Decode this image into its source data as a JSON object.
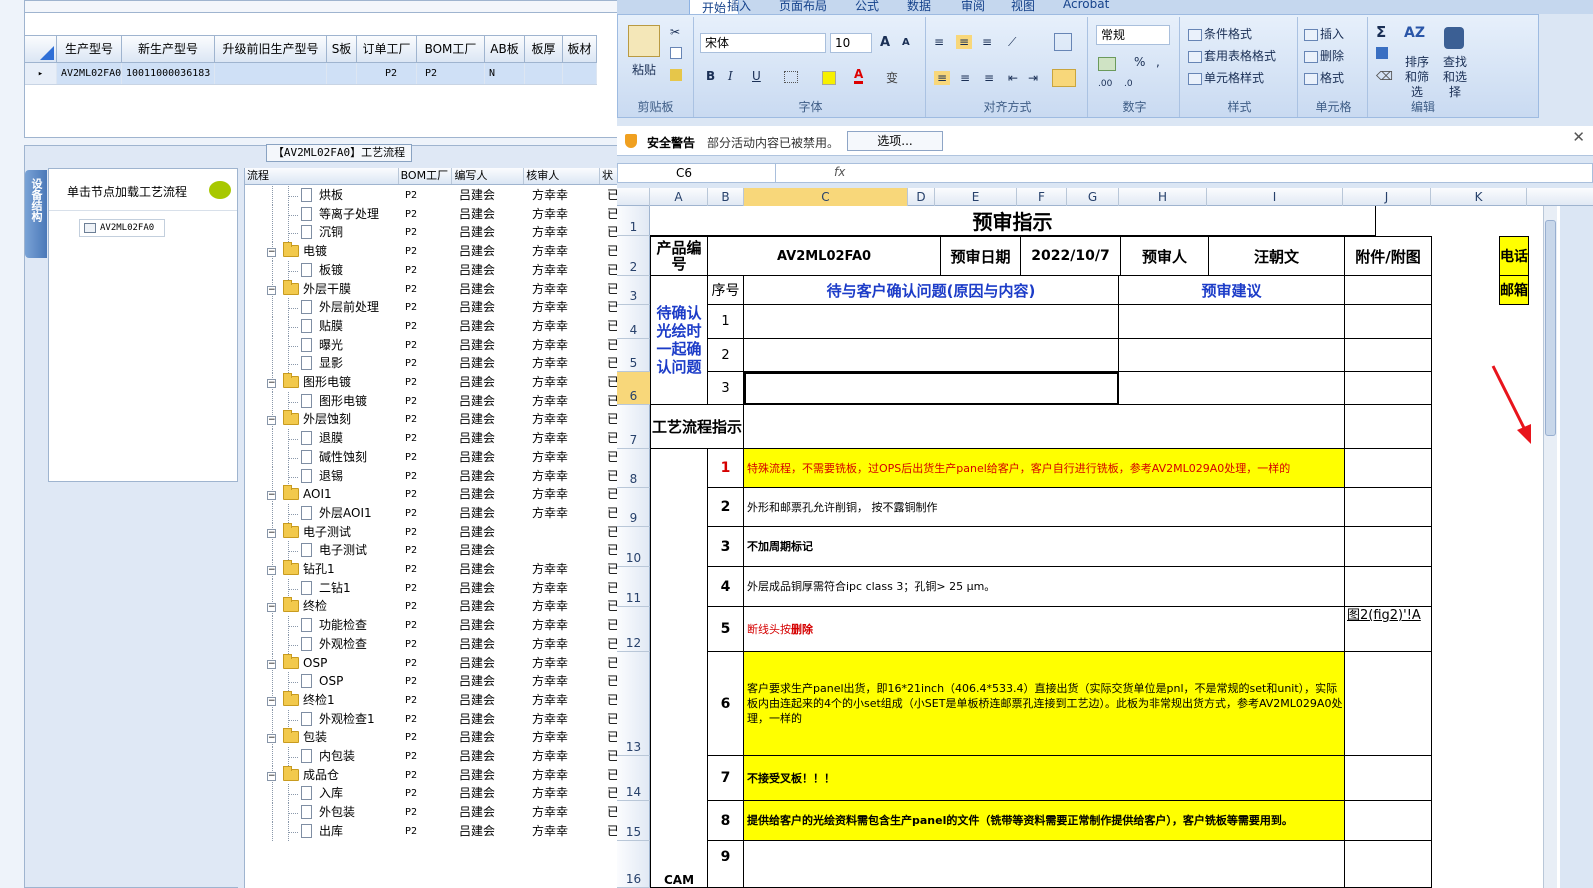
{
  "top_grid": {
    "headers": [
      "生产型号",
      "新生产型号",
      "升级前旧生产型号",
      "S板",
      "订单工厂",
      "BOM工厂",
      "AB板",
      "板厚",
      "板材"
    ],
    "row": {
      "pointer": "▸",
      "cells": [
        "AV2ML02FA0",
        "10011000036183",
        "",
        "",
        "P2",
        "P2",
        "N",
        "",
        ""
      ]
    }
  },
  "process_title": "【AV2ML02FA0】工艺流程",
  "side_tab": "设备结构",
  "left_pane": {
    "header": "单击节点加载工艺流程",
    "node": "AV2ML02FA0"
  },
  "tree": {
    "columns": [
      "流程",
      "BOM工厂",
      "编写人",
      "核审人",
      "状"
    ],
    "rows": [
      {
        "name": "烘板",
        "level": 1,
        "bom": "P2",
        "writer": "吕建会",
        "checker": "方幸幸",
        "status": "已"
      },
      {
        "name": "等离子处理",
        "level": 1,
        "bom": "P2",
        "writer": "吕建会",
        "checker": "方幸幸",
        "status": "已"
      },
      {
        "name": "沉铜",
        "level": 1,
        "bom": "P2",
        "writer": "吕建会",
        "checker": "方幸幸",
        "status": "已"
      },
      {
        "name": "电镀",
        "level": 0,
        "bom": "P2",
        "writer": "吕建会",
        "checker": "方幸幸",
        "status": "已"
      },
      {
        "name": "板镀",
        "level": 1,
        "bom": "P2",
        "writer": "吕建会",
        "checker": "方幸幸",
        "status": "已"
      },
      {
        "name": "外层干膜",
        "level": 0,
        "bom": "P2",
        "writer": "吕建会",
        "checker": "方幸幸",
        "status": "已"
      },
      {
        "name": "外层前处理",
        "level": 1,
        "bom": "P2",
        "writer": "吕建会",
        "checker": "方幸幸",
        "status": "已"
      },
      {
        "name": "贴膜",
        "level": 1,
        "bom": "P2",
        "writer": "吕建会",
        "checker": "方幸幸",
        "status": "已"
      },
      {
        "name": "曝光",
        "level": 1,
        "bom": "P2",
        "writer": "吕建会",
        "checker": "方幸幸",
        "status": "已"
      },
      {
        "name": "显影",
        "level": 1,
        "bom": "P2",
        "writer": "吕建会",
        "checker": "方幸幸",
        "status": "已"
      },
      {
        "name": "图形电镀",
        "level": 0,
        "bom": "P2",
        "writer": "吕建会",
        "checker": "方幸幸",
        "status": "已"
      },
      {
        "name": "图形电镀",
        "level": 1,
        "bom": "P2",
        "writer": "吕建会",
        "checker": "方幸幸",
        "status": "已"
      },
      {
        "name": "外层蚀刻",
        "level": 0,
        "bom": "P2",
        "writer": "吕建会",
        "checker": "方幸幸",
        "status": "已"
      },
      {
        "name": "退膜",
        "level": 1,
        "bom": "P2",
        "writer": "吕建会",
        "checker": "方幸幸",
        "status": "已"
      },
      {
        "name": "碱性蚀刻",
        "level": 1,
        "bom": "P2",
        "writer": "吕建会",
        "checker": "方幸幸",
        "status": "已"
      },
      {
        "name": "退锡",
        "level": 1,
        "bom": "P2",
        "writer": "吕建会",
        "checker": "方幸幸",
        "status": "已"
      },
      {
        "name": "AOI1",
        "level": 0,
        "bom": "P2",
        "writer": "吕建会",
        "checker": "方幸幸",
        "status": "已"
      },
      {
        "name": "外层AOI1",
        "level": 1,
        "bom": "P2",
        "writer": "吕建会",
        "checker": "方幸幸",
        "status": "已"
      },
      {
        "name": "电子测试",
        "level": 0,
        "bom": "P2",
        "writer": "吕建会",
        "checker": "",
        "status": "已"
      },
      {
        "name": "电子测试",
        "level": 1,
        "bom": "P2",
        "writer": "吕建会",
        "checker": "",
        "status": "已"
      },
      {
        "name": "钻孔1",
        "level": 0,
        "bom": "P2",
        "writer": "吕建会",
        "checker": "方幸幸",
        "status": "已"
      },
      {
        "name": "二钻1",
        "level": 1,
        "bom": "P2",
        "writer": "吕建会",
        "checker": "方幸幸",
        "status": "已"
      },
      {
        "name": "终检",
        "level": 0,
        "bom": "P2",
        "writer": "吕建会",
        "checker": "方幸幸",
        "status": "已"
      },
      {
        "name": "功能检查",
        "level": 1,
        "bom": "P2",
        "writer": "吕建会",
        "checker": "方幸幸",
        "status": "已"
      },
      {
        "name": "外观检查",
        "level": 1,
        "bom": "P2",
        "writer": "吕建会",
        "checker": "方幸幸",
        "status": "已"
      },
      {
        "name": "OSP",
        "level": 0,
        "bom": "P2",
        "writer": "吕建会",
        "checker": "方幸幸",
        "status": "已"
      },
      {
        "name": "OSP",
        "level": 1,
        "bom": "P2",
        "writer": "吕建会",
        "checker": "方幸幸",
        "status": "已"
      },
      {
        "name": "终检1",
        "level": 0,
        "bom": "P2",
        "writer": "吕建会",
        "checker": "方幸幸",
        "status": "已"
      },
      {
        "name": "外观检查1",
        "level": 1,
        "bom": "P2",
        "writer": "吕建会",
        "checker": "方幸幸",
        "status": "已"
      },
      {
        "name": "包装",
        "level": 0,
        "bom": "P2",
        "writer": "吕建会",
        "checker": "方幸幸",
        "status": "已"
      },
      {
        "name": "内包装",
        "level": 1,
        "bom": "P2",
        "writer": "吕建会",
        "checker": "方幸幸",
        "status": "已"
      },
      {
        "name": "成品仓",
        "level": 0,
        "bom": "P2",
        "writer": "吕建会",
        "checker": "方幸幸",
        "status": "已"
      },
      {
        "name": "入库",
        "level": 1,
        "bom": "P2",
        "writer": "吕建会",
        "checker": "方幸幸",
        "status": "已"
      },
      {
        "name": "外包装",
        "level": 1,
        "bom": "P2",
        "writer": "吕建会",
        "checker": "方幸幸",
        "status": "已"
      },
      {
        "name": "出库",
        "level": 1,
        "bom": "P2",
        "writer": "吕建会",
        "checker": "方幸幸",
        "status": "已"
      }
    ]
  },
  "excel": {
    "tabs": [
      "开始",
      "插入",
      "页面布局",
      "公式",
      "数据",
      "审阅",
      "视图",
      "Acrobat"
    ],
    "ribbon": {
      "clipboard": {
        "paste": "粘贴",
        "label": "剪贴板"
      },
      "font": {
        "name": "宋体",
        "size": "10",
        "label": "字体",
        "bold": "B",
        "italic": "I",
        "underline": "U",
        "grow": "A",
        "shrink": "A"
      },
      "align": {
        "label": "对齐方式"
      },
      "number": {
        "format": "常规",
        "label": "数字",
        "percent": "%"
      },
      "styles": {
        "cond": "条件格式",
        "table": "套用表格格式",
        "cell": "单元格样式",
        "label": "样式"
      },
      "cells": {
        "insert": "插入",
        "delete": "删除",
        "format": "格式",
        "label": "单元格"
      },
      "edit": {
        "sum": "Σ",
        "sort": "排序和筛选",
        "find": "查找和选择",
        "label": "编辑"
      }
    },
    "security": {
      "title": "安全警告",
      "message": "部分活动内容已被禁用。",
      "options": "选项..."
    },
    "name_box": "C6",
    "fx": "fx",
    "columns": [
      "A",
      "B",
      "C",
      "D",
      "E",
      "F",
      "G",
      "H",
      "I",
      "J",
      "K"
    ],
    "rows": [
      "1",
      "2",
      "3",
      "4",
      "5",
      "6",
      "7",
      "8",
      "9",
      "10",
      "11",
      "12",
      "13",
      "14",
      "15",
      "16"
    ],
    "sheet": {
      "title": "预审指示",
      "product_label": "产品编号",
      "product": "AV2ML02FA0",
      "date_label": "预审日期",
      "date": "2022/10/7",
      "reviewer_label": "预审人",
      "reviewer": "汪朝文",
      "attach_label": "附件/附图",
      "seq_label": "序号",
      "issue_label": "待与客户确认问题(原因与内容)",
      "advice_label": "预审建议",
      "confirm_label": "待确认光绘时一起确认问题",
      "confirm_nums": [
        "1",
        "2",
        "3"
      ],
      "process_label": "工艺流程指示",
      "right_labels": [
        "电话",
        "邮箱"
      ],
      "items": [
        {
          "n": "1",
          "text": "特殊流程，不需要铣板，过OPS后出货生产panel给客户，客户自行进行铣板，参考AV2ML029A0处理，一样的"
        },
        {
          "n": "2",
          "text": "外形和邮票孔允许削铜， 按不露铜制作"
        },
        {
          "n": "3",
          "text": "不加周期标记"
        },
        {
          "n": "4",
          "text": "外层成品铜厚需符合ipc class 3；孔铜> 25 μm。"
        },
        {
          "n": "5",
          "text_a": "断线头按",
          "text_b": "删除",
          "attach": "图2(fig2)'!A"
        },
        {
          "n": "6",
          "text": "客户要求生产panel出货，即16*21inch（406.4*533.4）直接出货（实际交货单位是pnl，不是常规的set和unit），实际板内由连起来的4个的小set组成（小SET是单板桥连邮票孔连接到工艺边）。此板为非常规出货方式，参考AV2ML029A0处理，一样的"
        },
        {
          "n": "7",
          "text": "不接受叉板！！！"
        },
        {
          "n": "8",
          "text": "提供给客户的光绘资料需包含生产panel的文件（铣带等资料需要正常制作提供给客户），客户铣板等需要用到。"
        },
        {
          "n": "9",
          "text": ""
        }
      ],
      "cam_label": "CAM"
    }
  },
  "colors": {
    "highlight": "#ffff00",
    "accent_red": "#d50000",
    "header_blue": "#1c3cc8"
  }
}
